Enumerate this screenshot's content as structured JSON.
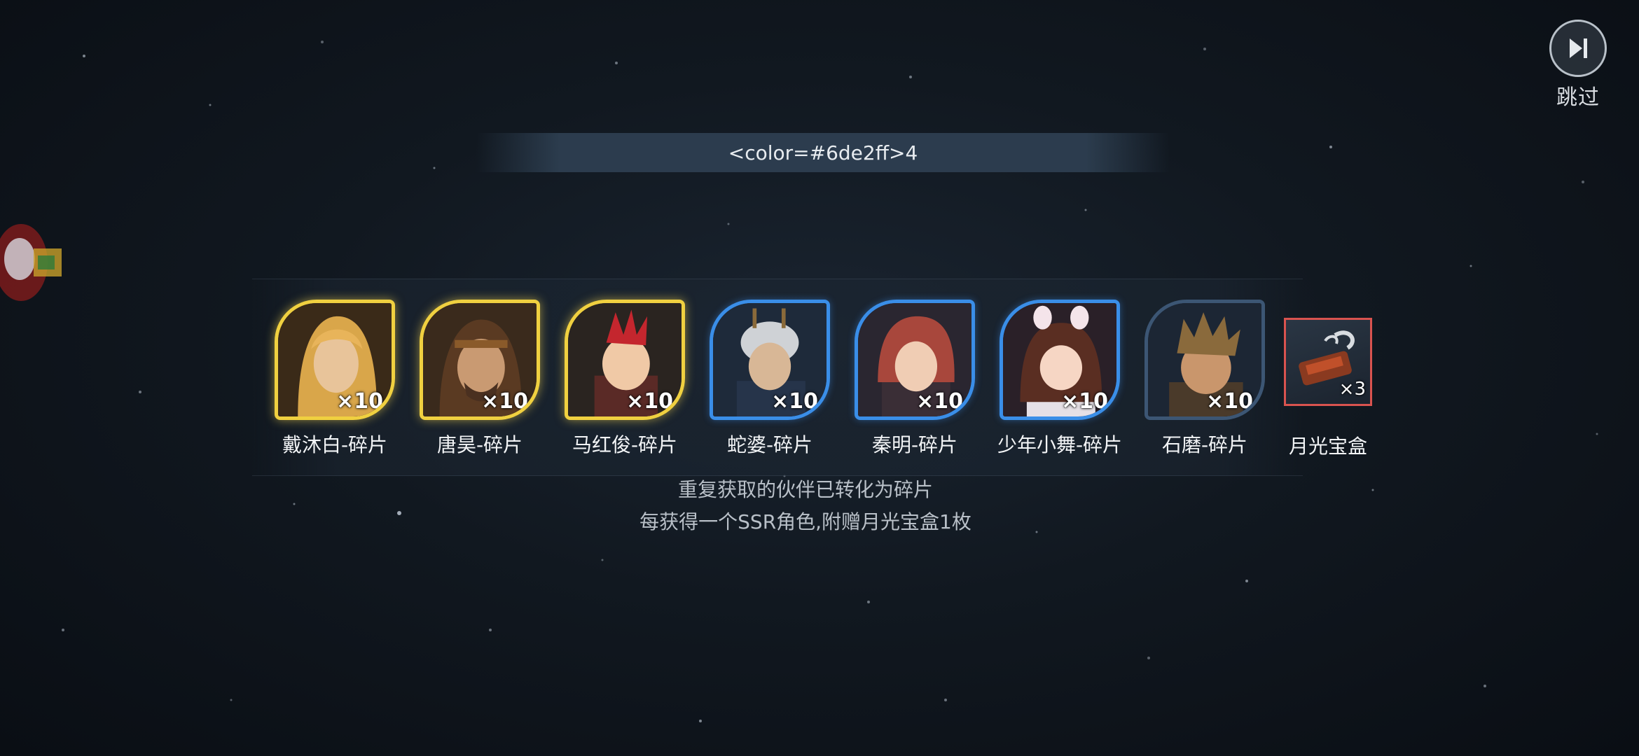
{
  "skip": {
    "label": "跳过"
  },
  "banner": {
    "text": "<color=#6de2ff>4"
  },
  "rewards": [
    {
      "name": "戴沐白-碎片",
      "count": "×10",
      "frame": "gold",
      "hair": "#d9a64a",
      "skin": "#e8c49a"
    },
    {
      "name": "唐昊-碎片",
      "count": "×10",
      "frame": "gold",
      "hair": "#5a3a22",
      "skin": "#c99a72"
    },
    {
      "name": "马红俊-碎片",
      "count": "×10",
      "frame": "gold",
      "hair": "#c4262e",
      "skin": "#f0c9a6"
    },
    {
      "name": "蛇婆-碎片",
      "count": "×10",
      "frame": "blue",
      "hair": "#cfd2d6",
      "skin": "#d8b796"
    },
    {
      "name": "秦明-碎片",
      "count": "×10",
      "frame": "blue",
      "hair": "#a8473c",
      "skin": "#f0cdb4"
    },
    {
      "name": "少年小舞-碎片",
      "count": "×10",
      "frame": "blue",
      "hair": "#5a2e22",
      "skin": "#f6d6c4"
    },
    {
      "name": "石磨-碎片",
      "count": "×10",
      "frame": "dark",
      "hair": "#8a6a3c",
      "skin": "#c9966c"
    }
  ],
  "box": {
    "name": "月光宝盒",
    "count": "×3"
  },
  "notes": {
    "line1": "重复获取的伙伴已转化为碎片",
    "line2": "每获得一个SSR角色,附赠月光宝盒1枚"
  },
  "colors": {
    "gold_frame": "#f0d040",
    "blue_frame": "#3a8ee8",
    "box_border": "#d9534f"
  }
}
